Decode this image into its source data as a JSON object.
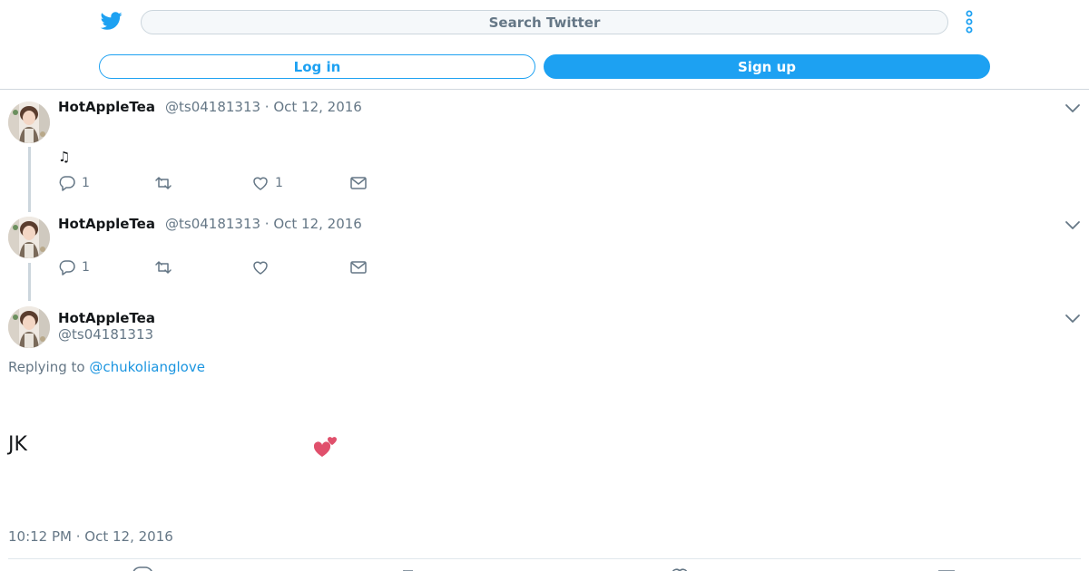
{
  "header": {
    "search_placeholder": "Search Twitter",
    "login_label": "Log in",
    "signup_label": "Sign up"
  },
  "colors": {
    "brand": "#1da1f2",
    "link": "#1b95e0",
    "muted": "#657786"
  },
  "tweets": [
    {
      "name": "HotAppleTea",
      "meta": "@ts04181313 · Oct 12, 2016",
      "text": "♫",
      "reply_count": "1",
      "retweet_count": "",
      "like_count": "1"
    },
    {
      "name": "HotAppleTea",
      "meta": "@ts04181313 · Oct 12, 2016",
      "text": "",
      "reply_count": "1",
      "retweet_count": "",
      "like_count": ""
    }
  ],
  "main_tweet": {
    "name": "HotAppleTea",
    "handle": "@ts04181313",
    "replying_prefix": "Replying to",
    "replying_to": "@chukolianglove",
    "text": "JK",
    "emoji_icon": "two-hearts-icon",
    "timestamp": "10:12 PM · Oct 12, 2016"
  }
}
